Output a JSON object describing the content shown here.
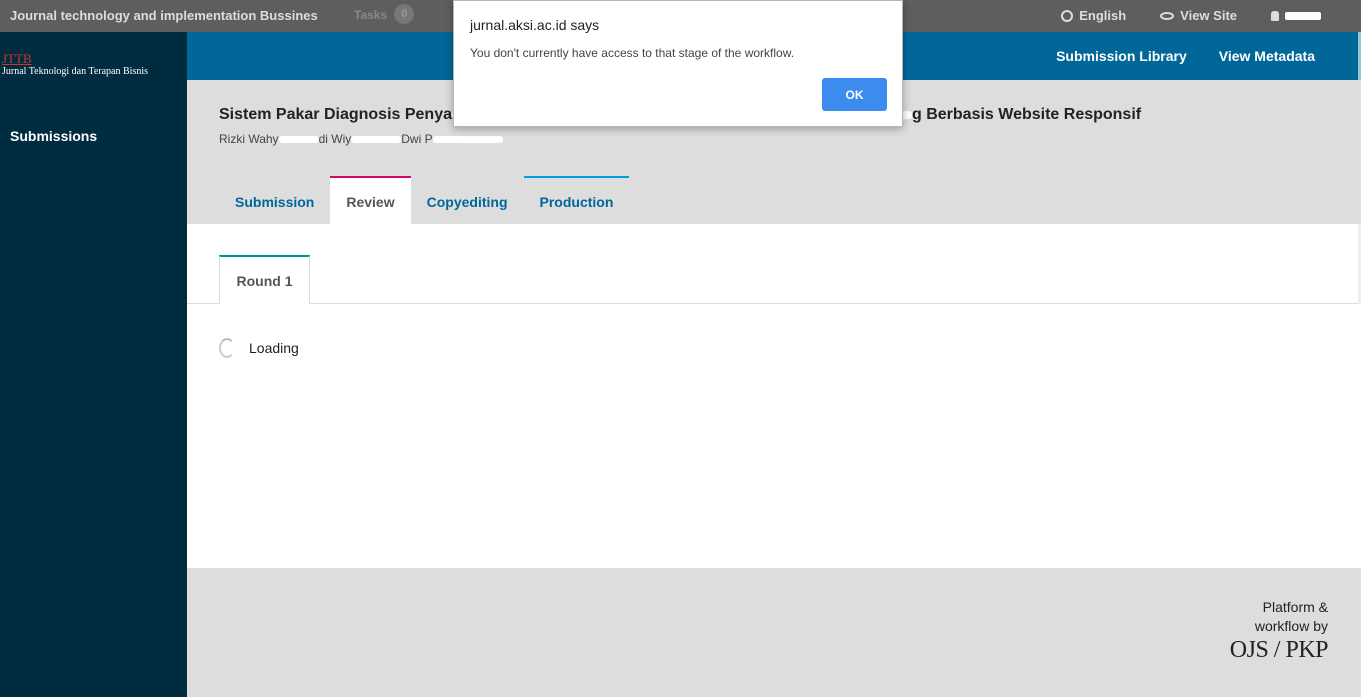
{
  "topbar": {
    "site_title": "Journal technology and implementation Bussines",
    "tasks_label": "Tasks",
    "tasks_count": "0",
    "language_label": "English",
    "view_site_label": "View Site"
  },
  "sidebar": {
    "logo_abbr": "JTTB",
    "logo_full": "Jurnal Teknologi dan Terapan Bisnis",
    "nav_submissions": "Submissions"
  },
  "header": {
    "submission_library": "Submission Library",
    "view_metadata": "View Metadata"
  },
  "submission": {
    "title_part1": "Sistem Pakar Diagnosis Penya",
    "title_part2": "g Berbasis Website Responsif",
    "authors_part1": "Rizki Wahy",
    "authors_part2": "di Wiy",
    "authors_part3": "Dwi P"
  },
  "tabs": [
    {
      "label": "Submission"
    },
    {
      "label": "Review"
    },
    {
      "label": "Copyediting"
    },
    {
      "label": "Production"
    }
  ],
  "review": {
    "round_label": "Round 1",
    "loading_text": "Loading"
  },
  "footer": {
    "platform_text_line1": "Platform &",
    "platform_text_line2": "workflow by",
    "platform_brand": "OJS / PKP"
  },
  "dialog": {
    "title": "jurnal.aksi.ac.id says",
    "message": "You don't currently have access to that stage of the workflow.",
    "ok_label": "OK"
  }
}
